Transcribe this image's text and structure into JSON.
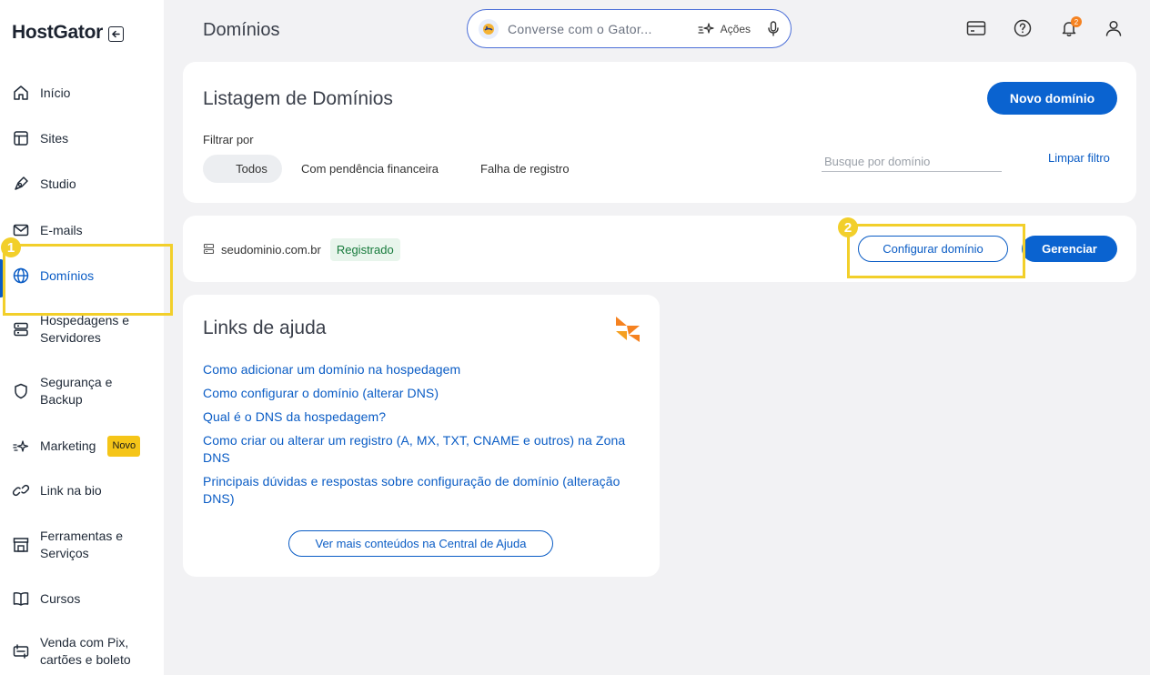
{
  "brand": {
    "name": "HostGator"
  },
  "header": {
    "title": "Domínios",
    "search_placeholder": "Converse com o Gator...",
    "actions_label": "Ações",
    "notification_count": "2"
  },
  "sidebar": {
    "items": [
      {
        "label": "Início",
        "icon": "home-icon"
      },
      {
        "label": "Sites",
        "icon": "layout-icon"
      },
      {
        "label": "Studio",
        "icon": "pen-tool-icon"
      },
      {
        "label": "E-mails",
        "icon": "mail-icon"
      },
      {
        "label": "Domínios",
        "icon": "globe-icon",
        "active": true
      },
      {
        "label": "Hospedagens e Servidores",
        "icon": "server-icon"
      },
      {
        "label": "Segurança e Backup",
        "icon": "shield-icon"
      },
      {
        "label": "Marketing",
        "icon": "sparkle-icon",
        "badge": "Novo"
      },
      {
        "label": "Link na bio",
        "icon": "link-icon"
      },
      {
        "label": "Ferramentas e Serviços",
        "icon": "store-icon"
      },
      {
        "label": "Cursos",
        "icon": "book-icon"
      },
      {
        "label": "Venda com Pix, cartões e boleto",
        "icon": "payment-icon"
      }
    ]
  },
  "listing": {
    "title": "Listagem de Domínios",
    "new_domain_label": "Novo domínio",
    "filter_label": "Filtrar por",
    "filters": [
      "Todos",
      "Com pendência financeira",
      "Falha de registro"
    ],
    "search_placeholder": "Busque por domínio",
    "clear_filter_label": "Limpar filtro"
  },
  "domain": {
    "name": "seudominio.com.br",
    "status": "Registrado",
    "configure_label": "Configurar domínio",
    "manage_label": "Gerenciar"
  },
  "help": {
    "title": "Links de ajuda",
    "links": [
      "Como adicionar um domínio na hospedagem",
      "Como configurar o domínio (alterar DNS)",
      "Qual é o DNS da hospedagem?",
      "Como criar ou alterar um registro (A, MX, TXT, CNAME e outros) na Zona DNS",
      "Principais dúvidas e respostas sobre configuração de domínio (alteração DNS)"
    ],
    "more_label": "Ver mais conteúdos na Central de Ajuda"
  },
  "annotations": {
    "step1": "1",
    "step2": "2"
  },
  "colors": {
    "primary": "#0a63d0",
    "highlight": "#f2cf2a",
    "notification": "#f58220"
  }
}
